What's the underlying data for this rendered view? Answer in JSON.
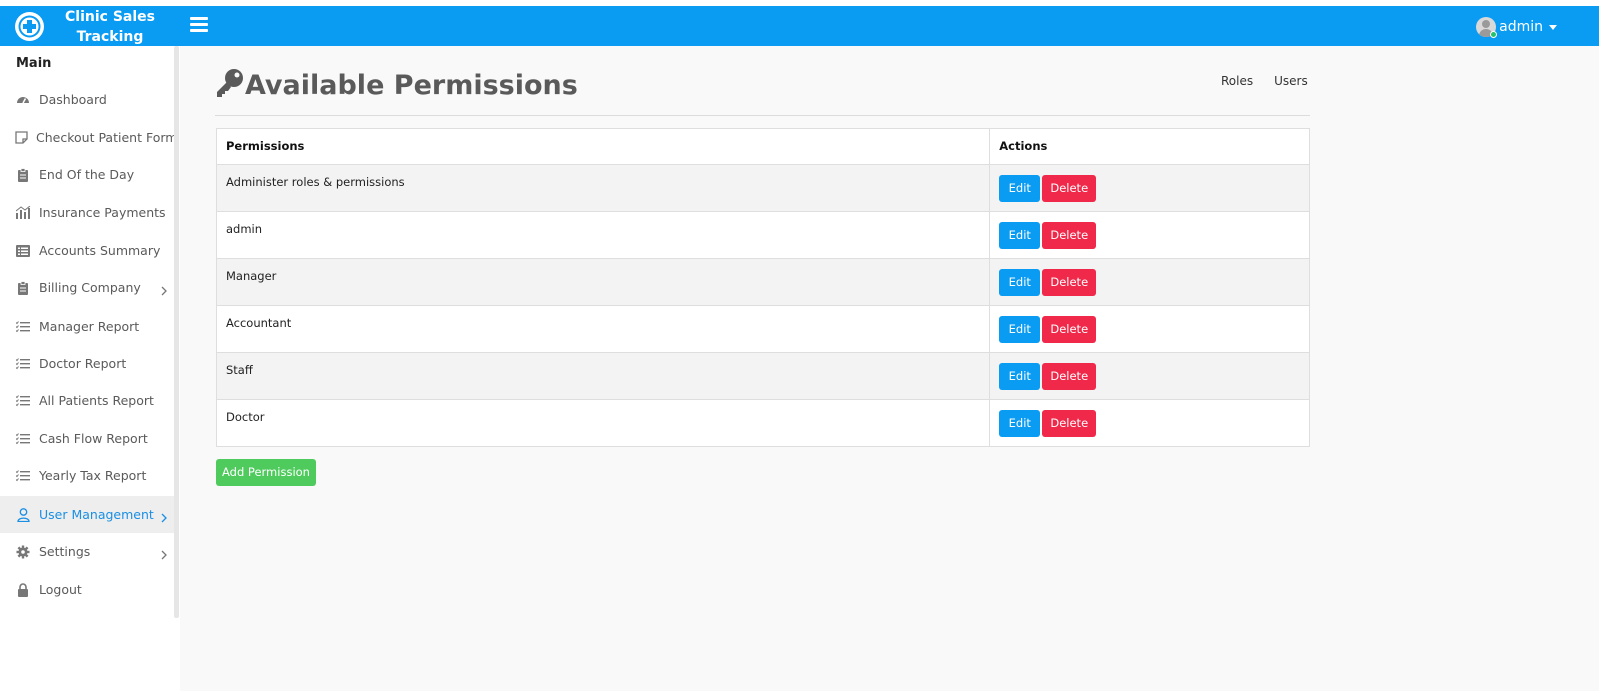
{
  "header": {
    "brand_name": "Clinic Sales Tracking",
    "user_name": "admin"
  },
  "sidebar": {
    "heading": "Main",
    "items": [
      {
        "label": "Dashboard",
        "icon": "speedometer-icon"
      },
      {
        "label": "Checkout Patient Form",
        "icon": "note-icon"
      },
      {
        "label": "End Of the Day",
        "icon": "clipboard-icon"
      },
      {
        "label": "Insurance Payments",
        "icon": "bar-chart-icon"
      },
      {
        "label": "Accounts Summary",
        "icon": "list-alt-icon"
      },
      {
        "label": "Billing Company",
        "icon": "clipboard-icon",
        "has_submenu": true
      },
      {
        "label": "Manager Report",
        "icon": "checklist-icon"
      },
      {
        "label": "Doctor Report",
        "icon": "checklist-icon"
      },
      {
        "label": "All Patients Report",
        "icon": "checklist-icon"
      },
      {
        "label": "Cash Flow Report",
        "icon": "checklist-icon"
      },
      {
        "label": "Yearly Tax Report",
        "icon": "checklist-icon"
      },
      {
        "label": "User Management",
        "icon": "user-icon",
        "has_submenu": true,
        "active": true
      },
      {
        "label": "Settings",
        "icon": "gear-icon",
        "has_submenu": true
      },
      {
        "label": "Logout",
        "icon": "lock-icon"
      }
    ]
  },
  "main": {
    "title": "Available Permissions",
    "title_icon": "key-icon",
    "links": [
      "Roles",
      "Users"
    ],
    "table": {
      "headers": [
        "Permissions",
        "Actions"
      ],
      "rows": [
        "Administer roles & permissions",
        "admin",
        "Manager",
        "Accountant",
        "Staff",
        "Doctor"
      ],
      "edit_label": "Edit",
      "delete_label": "Delete"
    },
    "add_button_label": "Add Permission"
  },
  "colors": {
    "primary": "#0a9bf3",
    "danger": "#f0284a",
    "success": "#4fcb5e",
    "active_text": "#1a8fe3"
  }
}
